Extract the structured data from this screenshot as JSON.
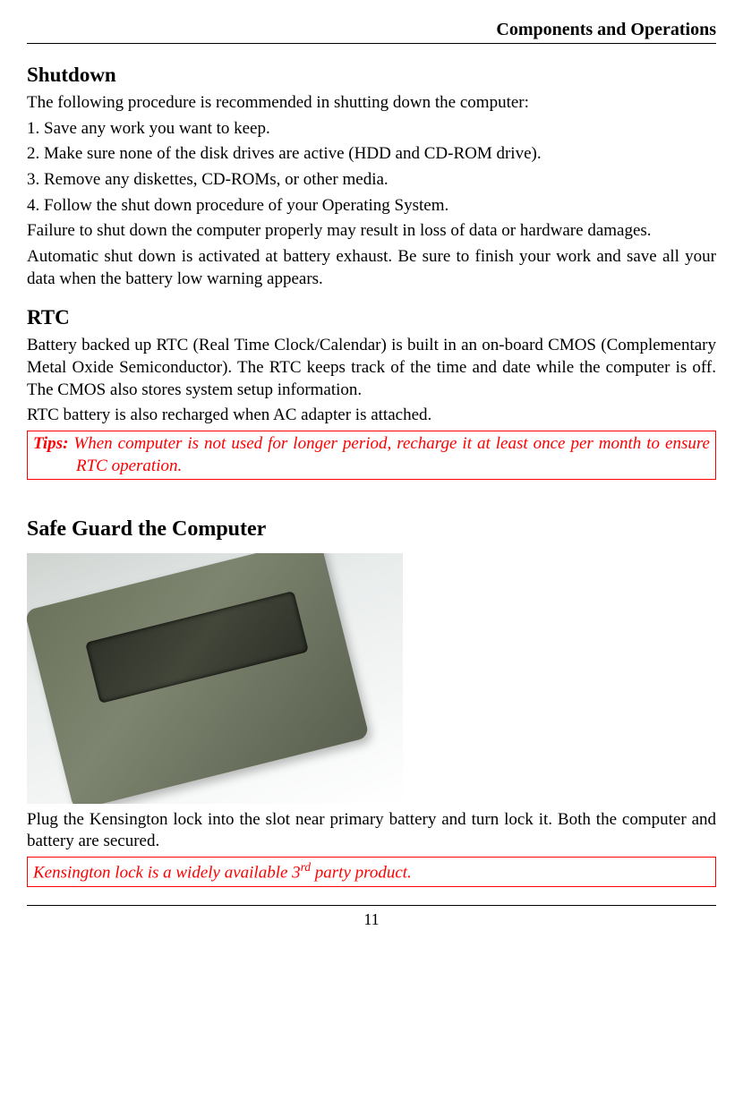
{
  "header": {
    "title": "Components and Operations"
  },
  "shutdown": {
    "heading": "Shutdown",
    "intro": "The following procedure is recommended in shutting down the computer:",
    "steps": [
      "1. Save any work you want to keep.",
      "2. Make sure none of the disk drives are active (HDD and CD-ROM drive).",
      "3. Remove any diskettes, CD-ROMs, or other media.",
      "4. Follow the shut down procedure of your Operating System."
    ],
    "warning": "Failure to shut down the computer properly may result in loss of data or hardware damages.",
    "auto_shutdown": "Automatic shut down is activated at battery exhaust. Be sure to finish your work and save all your data when the battery low warning appears."
  },
  "rtc": {
    "heading": "RTC",
    "body": "Battery backed up RTC (Real Time Clock/Calendar) is built in an on-board CMOS (Complementary Metal Oxide Semiconductor). The RTC keeps track of the time and date while the computer is off. The CMOS also stores system setup information.",
    "recharge": "RTC battery is also recharged when AC adapter is attached.",
    "tip_label": "Tips:",
    "tip_text": " When computer is not used for longer period, recharge it at least once per month to ensure RTC operation."
  },
  "safeguard": {
    "heading": "Safe Guard the Computer",
    "image_alt": "Photograph of rugged laptop corner showing Kensington lock slot near battery",
    "body": "Plug the Kensington lock into the slot near primary battery and turn lock it. Both the computer and battery are secured.",
    "note_pre": "Kensington lock is a widely available 3",
    "note_sup": "rd",
    "note_post": " party product."
  },
  "footer": {
    "page_number": "11"
  }
}
